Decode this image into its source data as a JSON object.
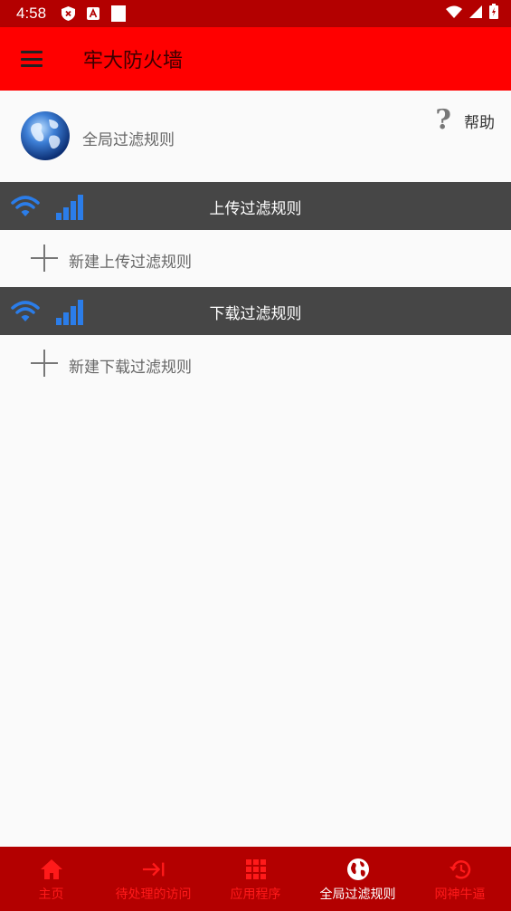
{
  "status_bar": {
    "time": "4:58",
    "icons": [
      "shield-x-icon",
      "font-a-icon",
      "blank-square-icon",
      "wifi-icon",
      "signal-icon",
      "battery-charging-icon"
    ]
  },
  "app_bar": {
    "title": "牢大防火墙",
    "menu_icon": "hamburger-menu-icon",
    "color": "#ff0000"
  },
  "global": {
    "label": "全局过滤规则",
    "help_label": "帮助",
    "globe_icon": "globe-icon",
    "help_icon": "question-mark-icon"
  },
  "upload": {
    "title": "上传过滤规则",
    "new_rule": "新建上传过滤规则"
  },
  "download": {
    "title": "下载过滤规则",
    "new_rule": "新建下载过滤规则"
  },
  "bottom_nav": {
    "items": [
      {
        "label": "主页",
        "icon": "home-icon",
        "active": false
      },
      {
        "label": "待处理的访问",
        "icon": "arrow-to-bar-icon",
        "active": false
      },
      {
        "label": "应用程序",
        "icon": "grid-icon",
        "active": false
      },
      {
        "label": "全局过滤规则",
        "icon": "globe-icon",
        "active": true
      },
      {
        "label": "网神牛逼",
        "icon": "history-icon",
        "active": false
      }
    ]
  },
  "colors": {
    "status_bar": "#b30000",
    "section_bar": "#464646",
    "accent_blue": "#2b7de9",
    "nav_inactive": "#ff1a1a"
  }
}
